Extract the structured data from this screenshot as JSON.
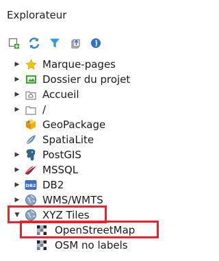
{
  "panel": {
    "title": "Explorateur"
  },
  "toolbar": {
    "buttons": [
      {
        "name": "add-layer-button",
        "icon": "add-layer-icon"
      },
      {
        "name": "refresh-button",
        "icon": "refresh-icon"
      },
      {
        "name": "filter-button",
        "icon": "filter-icon"
      },
      {
        "name": "collapse-all-button",
        "icon": "collapse-all-icon"
      },
      {
        "name": "properties-button",
        "icon": "info-icon"
      }
    ]
  },
  "tree": {
    "items": [
      {
        "label": "Marque-pages",
        "icon": "star-icon",
        "expander": "collapsed"
      },
      {
        "label": "Dossier du projet",
        "icon": "project-folder-icon",
        "expander": "collapsed"
      },
      {
        "label": "Accueil",
        "icon": "home-folder-icon",
        "expander": "collapsed"
      },
      {
        "label": "/",
        "icon": "folder-icon",
        "expander": "collapsed"
      },
      {
        "label": "GeoPackage",
        "icon": "geopackage-icon",
        "expander": "none"
      },
      {
        "label": "SpatiaLite",
        "icon": "spatialite-icon",
        "expander": "none"
      },
      {
        "label": "PostGIS",
        "icon": "postgis-icon",
        "expander": "collapsed"
      },
      {
        "label": "MSSQL",
        "icon": "mssql-icon",
        "expander": "collapsed"
      },
      {
        "label": "DB2",
        "icon": "db2-icon",
        "expander": "collapsed"
      },
      {
        "label": "WMS/WMTS",
        "icon": "globe-icon",
        "expander": "collapsed"
      },
      {
        "label": "XYZ Tiles",
        "icon": "globe-icon",
        "expander": "expanded"
      },
      {
        "label": "OpenStreetMap",
        "icon": "xyz-tile-icon",
        "expander": "none"
      },
      {
        "label": "OSM no labels",
        "icon": "xyz-tile-icon",
        "expander": "none"
      }
    ]
  },
  "colors": {
    "highlight": "#e8232a",
    "star": "#f5c400",
    "project": "#3fa035",
    "postgis": "#336791",
    "mssql": "#a61c2b",
    "db2": "#3b6fc4",
    "info": "#2f6fd0",
    "filter": "#2e9bd6"
  }
}
